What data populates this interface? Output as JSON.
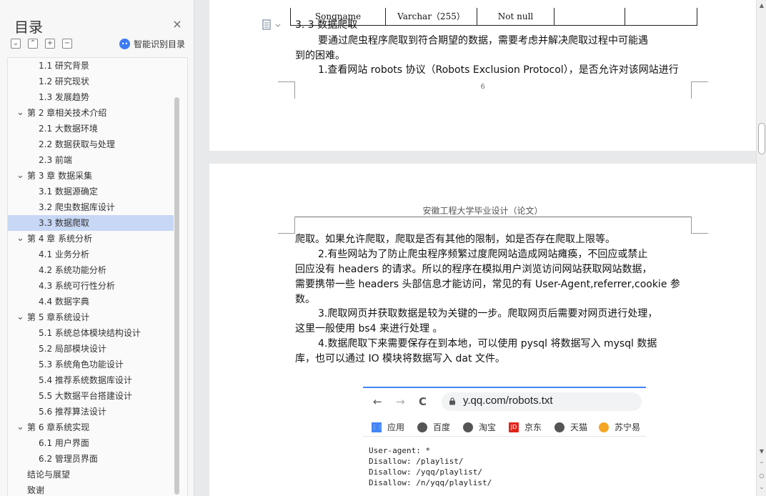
{
  "toc": {
    "title": "目录",
    "close_glyph": "×",
    "smart_toc_label": "智能识别目录",
    "toolbar": {
      "collapse": "⌄",
      "expand": "⌃",
      "add": "+",
      "remove": "−"
    },
    "items": [
      {
        "label": "1.1  研究背景",
        "level": 2
      },
      {
        "label": "1.2  研究现状",
        "level": 2
      },
      {
        "label": "1.3  发展趋势",
        "level": 2
      },
      {
        "label": "第 2 章相关技术介绍",
        "level": 1
      },
      {
        "label": "2.1  大数据环境",
        "level": 2
      },
      {
        "label": "2.2  数据获取与处理",
        "level": 2
      },
      {
        "label": "2.3 前端",
        "level": 2
      },
      {
        "label": "第 3 章  数据采集",
        "level": 1
      },
      {
        "label": "3.1  数据源确定",
        "level": 2
      },
      {
        "label": "3.2  爬虫数据库设计",
        "level": 2
      },
      {
        "label": "3.3  数据爬取",
        "level": 2,
        "active": true
      },
      {
        "label": "第 4 章  系统分析",
        "level": 1
      },
      {
        "label": "4.1  业务分析",
        "level": 2
      },
      {
        "label": "4.2  系统功能分析",
        "level": 2
      },
      {
        "label": "4.3  系统可行性分析",
        "level": 2
      },
      {
        "label": "4.4  数据字典",
        "level": 2
      },
      {
        "label": "第 5 章系统设计",
        "level": 1
      },
      {
        "label": "5.1  系统总体模块结构设计",
        "level": 2
      },
      {
        "label": "5.2  局部模块设计",
        "level": 2
      },
      {
        "label": "5.3  系统角色功能设计",
        "level": 2
      },
      {
        "label": "5.4  推荐系统数据库设计",
        "level": 2
      },
      {
        "label": "5.5  大数据平台搭建设计",
        "level": 2
      },
      {
        "label": "5.6  推荐算法设计",
        "level": 2
      },
      {
        "label": "第 6 章系统实现",
        "level": 1
      },
      {
        "label": "6.1  用户界面",
        "level": 2
      },
      {
        "label": "6.2  管理员界面",
        "level": 2
      },
      {
        "label": "结论与展望",
        "level": 0
      },
      {
        "label": "致谢",
        "level": 0
      }
    ]
  },
  "doc": {
    "table_row": [
      "Songname",
      "Varchar（255）",
      "Not null",
      "",
      ""
    ],
    "section_heading": "3. 3  数据爬取",
    "para1_line1": "要通过爬虫程序爬取到符合期望的数据，需要考虑并解决爬取过程中可能遇",
    "para1_line2": "到的困难。",
    "para2_line1": "1.查看网站 robots 协议（Robots Exclusion Protocol），是否允许对该网站进行",
    "page_number": "6",
    "page_header": "安徽工程大学毕业设计（论文）",
    "p_lines": [
      "爬取。如果允许爬取，爬取是否有其他的限制，如是否存在爬取上限等。",
      "2.有些网站为了防止爬虫程序频繁过度爬网站造成网站瘫痪，不回应或禁止",
      "回应没有 headers 的请求。所以的程序在模拟用户浏览访问网站获取网站数据，",
      "需要携带一些 headers 头部信息才能访问，常见的有 User-Agent,referrer,cookie 参",
      "数。",
      "3.爬取网页并获取数据是较为关键的一步。爬取网页后需要对网页进行处理，",
      "这里一般使用 bs4 来进行处理 。",
      "4.数据爬取下来需要保存在到本地，可以使用 pysql 将数据写入 mysql 数据",
      "库，也可以通过 IO 模块将数据写入 dat 文件。"
    ]
  },
  "browser": {
    "url": "y.qq.com/robots.txt",
    "nav": {
      "back": "←",
      "forward": "→",
      "reload": "C"
    },
    "bookmarks": [
      {
        "label": "应用",
        "icon": "apps-icon",
        "color": "#4285f4"
      },
      {
        "label": "百度",
        "icon": "globe-icon",
        "color": "#555555"
      },
      {
        "label": "淘宝",
        "icon": "globe-icon",
        "color": "#555555"
      },
      {
        "label": "京东",
        "icon": "jd-icon",
        "color": "#e1251b"
      },
      {
        "label": "天猫",
        "icon": "globe-icon",
        "color": "#555555"
      },
      {
        "label": "苏宁易",
        "icon": "suning-icon",
        "color": "#f5a623"
      }
    ],
    "content": "User-agent: *\nDisallow: /playlist/\nDisallow: /yqq/playlist/\nDisallow: /n/yqq/playlist/"
  },
  "colors": {
    "active_toc": "#c7d7f5",
    "accent": "#4285f4"
  }
}
